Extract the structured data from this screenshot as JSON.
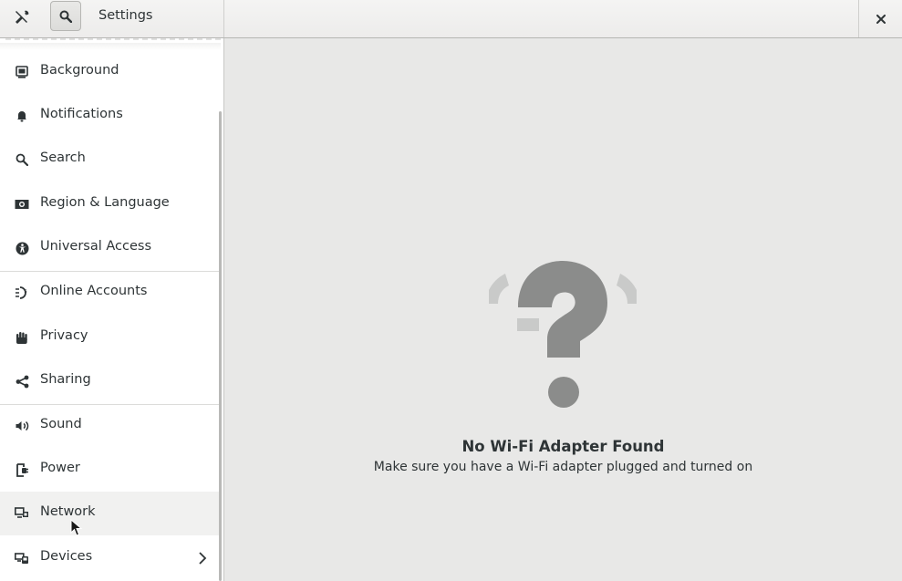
{
  "header": {
    "title": "Settings",
    "tools_icon": "tools-icon",
    "search_icon": "search-icon",
    "close_icon": "close-icon",
    "close_label": "×"
  },
  "sidebar": {
    "items": [
      {
        "label": "Background",
        "icon": "background-icon"
      },
      {
        "label": "Notifications",
        "icon": "bell-icon"
      },
      {
        "label": "Search",
        "icon": "search-icon"
      },
      {
        "label": "Region & Language",
        "icon": "region-icon"
      },
      {
        "label": "Universal Access",
        "icon": "accessibility-icon"
      },
      {
        "label": "Online Accounts",
        "icon": "online-accounts-icon"
      },
      {
        "label": "Privacy",
        "icon": "hand-icon"
      },
      {
        "label": "Sharing",
        "icon": "share-icon"
      },
      {
        "label": "Sound",
        "icon": "speaker-icon"
      },
      {
        "label": "Power",
        "icon": "power-icon"
      },
      {
        "label": "Network",
        "icon": "network-icon"
      },
      {
        "label": "Devices",
        "icon": "devices-icon"
      }
    ],
    "hovered_item": "Network"
  },
  "main": {
    "placeholder_icon": "question-mark-icon",
    "empty_title": "No Wi-Fi Adapter Found",
    "empty_subtitle": "Make sure you have a Wi-Fi adapter plugged and turned on"
  },
  "colors": {
    "icon": "#2e3436",
    "placeholder": "#8b8c8b",
    "sidebar_bg": "#ffffff",
    "main_bg": "#e8e8e7"
  }
}
